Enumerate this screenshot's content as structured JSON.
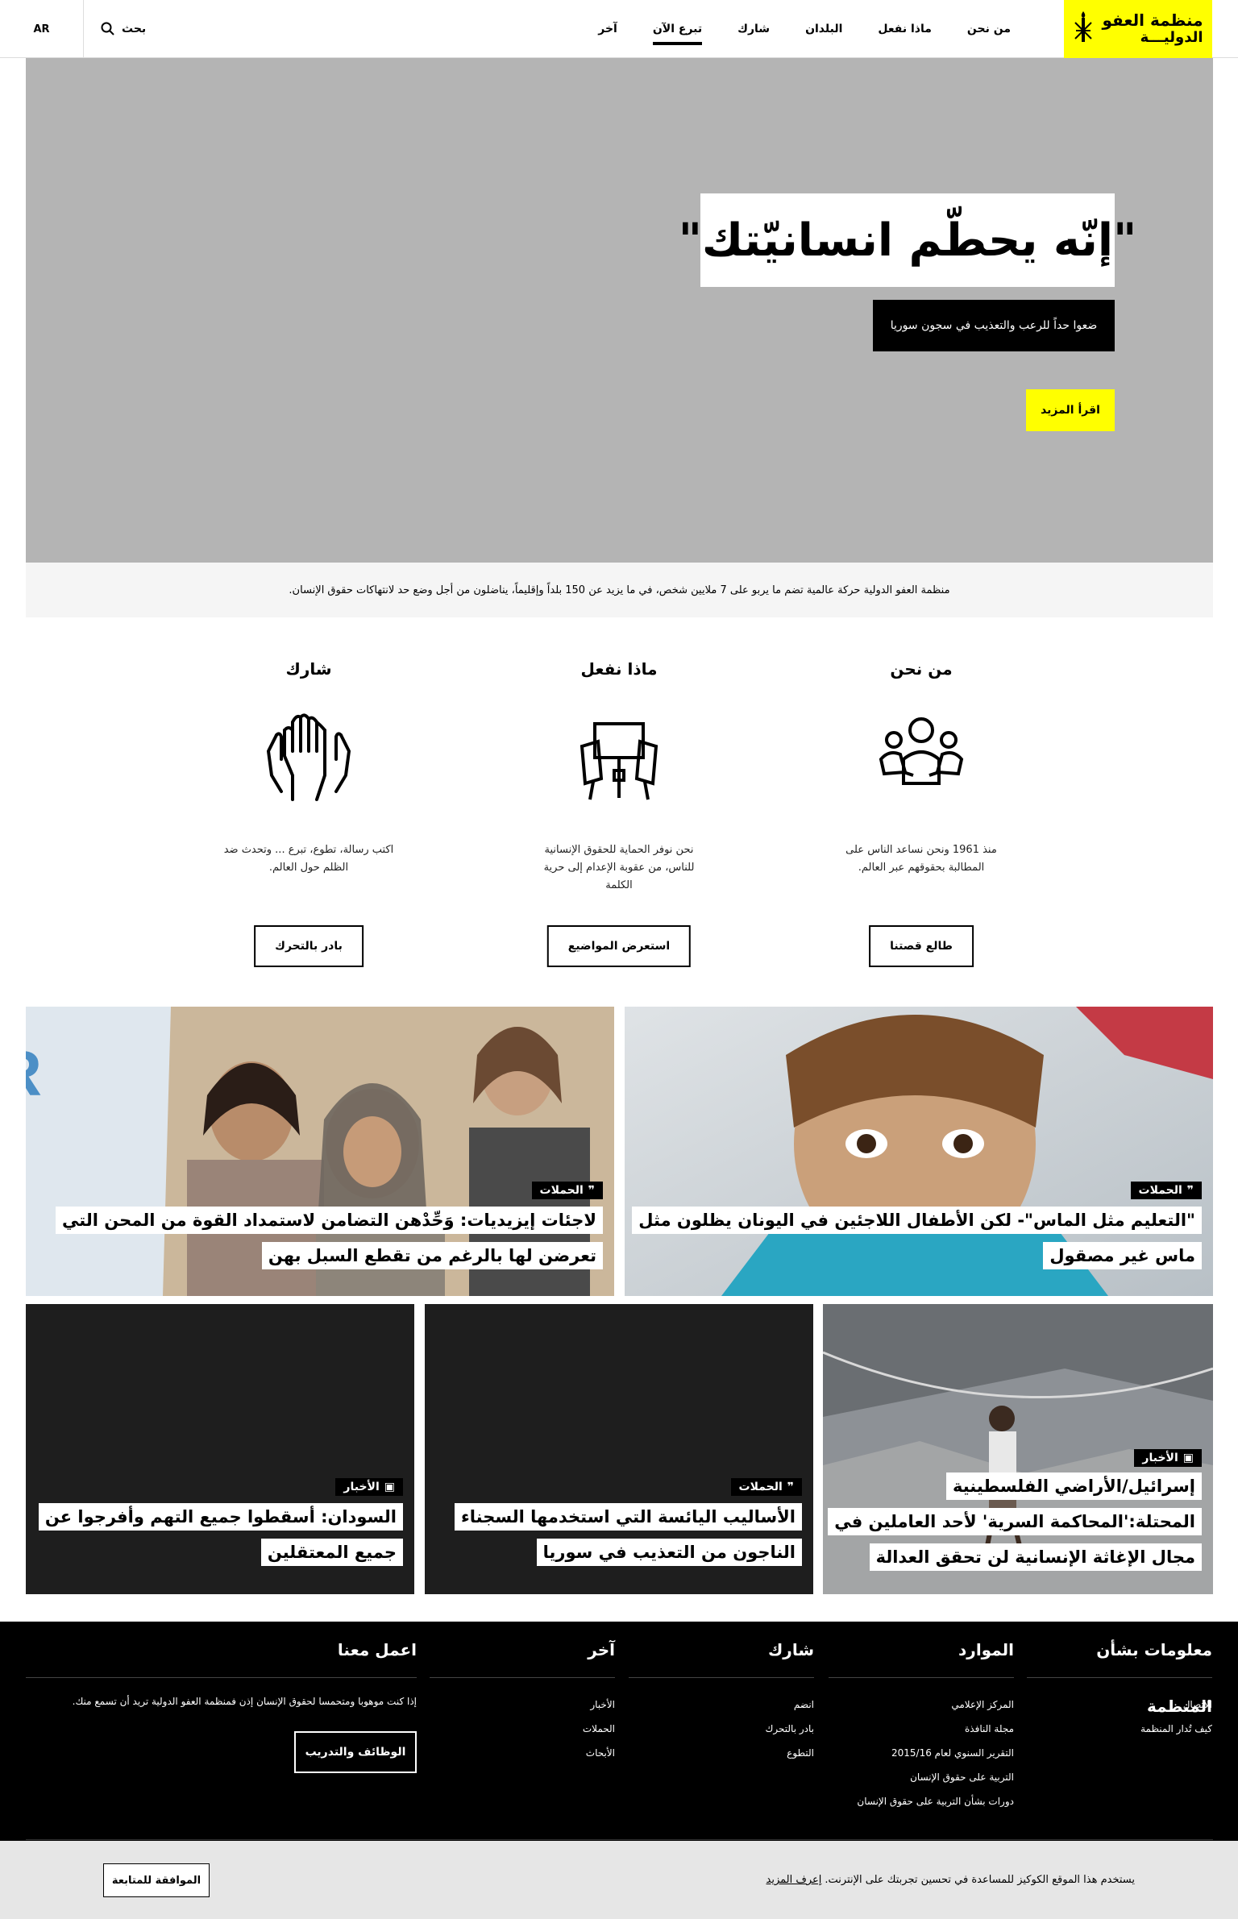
{
  "header": {
    "logo_line1": "منظمة العفو",
    "logo_line2": "الدوليـــة",
    "nav": [
      "من نحن",
      "ماذا نفعل",
      "البلدان",
      "شارك",
      "تبرع الآن",
      "آخر"
    ],
    "active_nav": "تبرع الآن",
    "search_label": "بحث",
    "lang": "AR"
  },
  "hero": {
    "title": "\"إنّه يحطّم انسانيّتك\"",
    "subtitle": "ضعوا حداً للرعب والتعذيب في سجون سوريا",
    "button": "اقرأ المزيد"
  },
  "intro": "منظمة العفو الدولية حركة عالمية تضم ما يربو على 7 ملايين شخص، في ما يزيد عن 150 بلداً وإقليماً، يناضلون من أجل وضع حد لانتهاكات حقوق الإنسان.",
  "columns": [
    {
      "title": "من نحن",
      "icon": "people-icon",
      "text": "منذ 1961 ونحن نساعد الناس على المطالبة بحقوقهم عبر العالم.",
      "button": "طالع قصتنا"
    },
    {
      "title": "ماذا نفعل",
      "icon": "placards-icon",
      "text": "نحن نوفر الحماية للحقوق الإنسانية للناس، من عقوبة الإعدام إلى حرية الكلمة",
      "button": "استعرض المواضيع"
    },
    {
      "title": "شارك",
      "icon": "raised-hands-icon",
      "text": "اكتب رسالة، تطوع، تبرع ... وتحدث ضد الظلم حول العالم.",
      "button": "بادر بالتحرك"
    }
  ],
  "cards": [
    {
      "label": "الحملات",
      "label_icon": "quote-icon",
      "title": "\"التعليم مثل الماس\"- لكن الأطفال اللاجئين في اليونان يظلون مثل ماس غير مصقول"
    },
    {
      "label": "الحملات",
      "label_icon": "quote-icon",
      "title": "لاجئات إيزيديات: وَحِّدْهن التضامن لاستمداد القوة من المحن التي تعرضن لها بالرغم من تقطع السبل بهن"
    },
    {
      "label": "الأخبار",
      "label_icon": "newspaper-icon",
      "title": "إسرائيل/الأراضي الفلسطينية المحتلة:'المحاكمة السرية' لأحد العاملين في مجال الإغاثة الإنسانية لن تحقق العدالة"
    },
    {
      "label": "الحملات",
      "label_icon": "quote-icon",
      "title": "الأساليب اليائسة التي استخدمها السجناء الناجون من التعذيب في سوريا"
    },
    {
      "label": "الأخبار",
      "label_icon": "newspaper-icon",
      "title": "السودان: أسقطوا جميع التهم وأفرجوا عن جميع المعتقلين"
    }
  ],
  "footer": {
    "about": {
      "title": "معلومات بشأن المنظمة",
      "items": [
        "الاتصال",
        "كيف تُدار المنظمة"
      ]
    },
    "resources": {
      "title": "الموارد",
      "items": [
        "المركز الإعلامي",
        "مجلة النافذة",
        "التقرير السنوي لعام 2015/16",
        "التربية على حقوق الإنسان",
        "دورات بشأن التربية على حقوق الإنسان"
      ]
    },
    "participate": {
      "title": "شارك",
      "items": [
        "انضم",
        "بادر بالتحرك",
        "التطوع"
      ]
    },
    "latest": {
      "title": "آخر",
      "items": [
        "الأخبار",
        "الحملات",
        "الأبحاث"
      ]
    },
    "work": {
      "title": "اعمل معنا",
      "text": "إذا كنت موهوبا ومتحمسا لحقوق الإنسان إذن فمنظمة العفو الدولية تريد أن تسمع منك.",
      "button": "الوظائف والتدريب"
    }
  },
  "cookie": {
    "text": "يستخدم هذا الموقع الكوكيز للمساعدة في تحسين تجربتك على الإنترنت.",
    "link": "إعرف المزيد",
    "button": "الموافقة للمتابعة"
  },
  "colors": {
    "accent": "#ffff00",
    "dark": "#000000",
    "hero_bg": "#b4b4b4"
  }
}
